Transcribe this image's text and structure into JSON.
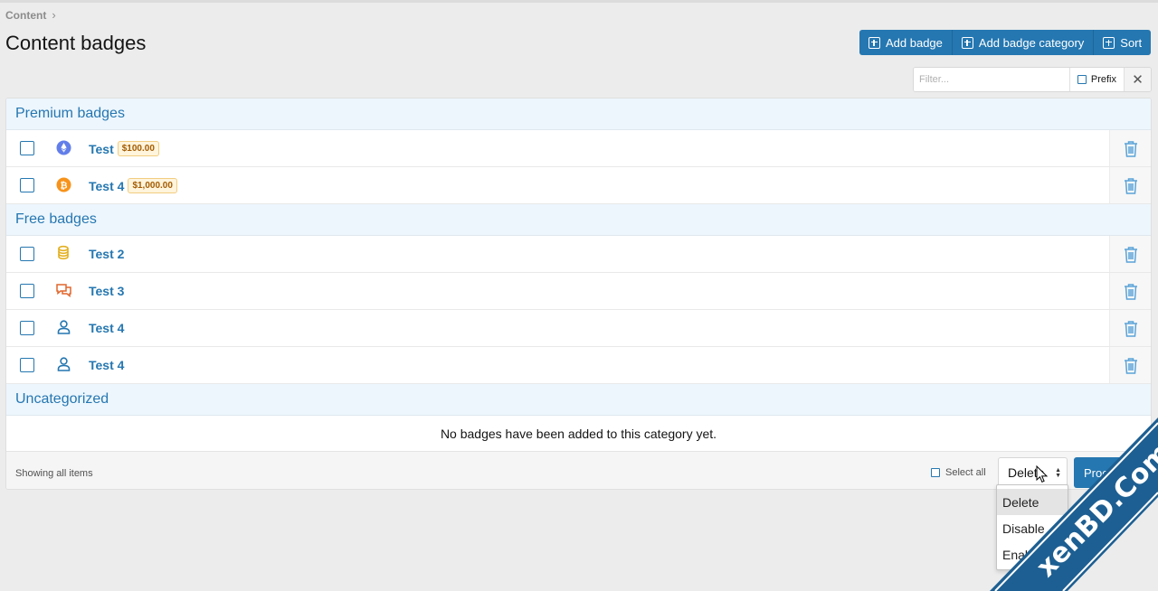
{
  "breadcrumb": {
    "item": "Content"
  },
  "page": {
    "title": "Content badges"
  },
  "actions": [
    {
      "label": "Add badge"
    },
    {
      "label": "Add badge category"
    },
    {
      "label": "Sort"
    }
  ],
  "filter": {
    "placeholder": "Filter...",
    "prefix_label": "Prefix"
  },
  "categories": [
    {
      "name": "Premium badges",
      "items": [
        {
          "title": "Test",
          "price": "$100.00",
          "icon": "ethereum-icon"
        },
        {
          "title": "Test 4",
          "price": "$1,000.00",
          "icon": "bitcoin-icon"
        }
      ]
    },
    {
      "name": "Free badges",
      "items": [
        {
          "title": "Test 2",
          "icon": "coins-icon"
        },
        {
          "title": "Test 3",
          "icon": "comments-icon"
        },
        {
          "title": "Test 4",
          "icon": "user-icon"
        },
        {
          "title": "Test 4",
          "icon": "user-icon"
        }
      ]
    },
    {
      "name": "Uncategorized",
      "empty_message": "No badges have been added to this category yet."
    }
  ],
  "footer": {
    "status": "Showing all items",
    "select_all": "Select all",
    "action_value": "Delete",
    "proceed_label": "Proceed..."
  },
  "dropdown": {
    "options": [
      "Delete",
      "Disable",
      "Enable"
    ],
    "selected": "Delete"
  },
  "watermark": {
    "text": "xenBD.Com"
  },
  "colors": {
    "accent": "#2577b1",
    "category_bg": "#edf6fd",
    "badge_bg": "#fff4dc",
    "badge_text": "#a35b00",
    "ethereum": "#627eea",
    "bitcoin": "#f7931a",
    "coins": "#e2b021",
    "comments": "#e0672d"
  }
}
